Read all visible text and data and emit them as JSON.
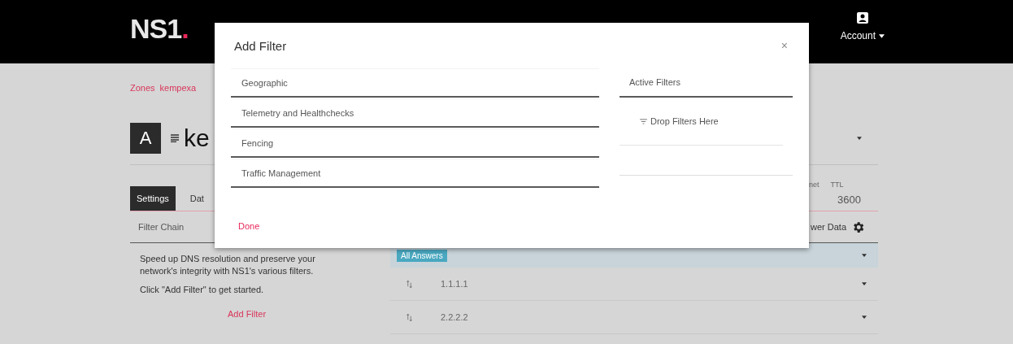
{
  "header": {
    "logo": "NS1",
    "logo_dot": ".",
    "account": "Account"
  },
  "breadcrumbs": [
    "Zones",
    "kempexa"
  ],
  "record": {
    "type": "A",
    "name": "ke"
  },
  "meta_labels": [
    "net",
    "TTL"
  ],
  "ttl": "3600",
  "tabs": [
    {
      "label": "Settings",
      "selected": true
    },
    {
      "label": "Dat",
      "selected": false
    }
  ],
  "filter_chain": {
    "title": "Filter Chain",
    "description": "Speed up DNS resolution and preserve your network's integrity with NS1's various filters.",
    "hint": "Click \"Add Filter\" to get started.",
    "action": "Add Filter"
  },
  "answers": {
    "title": "wer Data",
    "group": "All Answers",
    "rows": [
      {
        "value": "1.1.1.1"
      },
      {
        "value": "2.2.2.2"
      }
    ]
  },
  "dialog": {
    "title": "Add Filter",
    "close": "×",
    "categories": [
      "Geographic",
      "Telemetry and Healthchecks",
      "Fencing",
      "Traffic Management"
    ],
    "active_title": "Active Filters",
    "drop_hint": "Drop Filters Here",
    "done": "Done"
  }
}
